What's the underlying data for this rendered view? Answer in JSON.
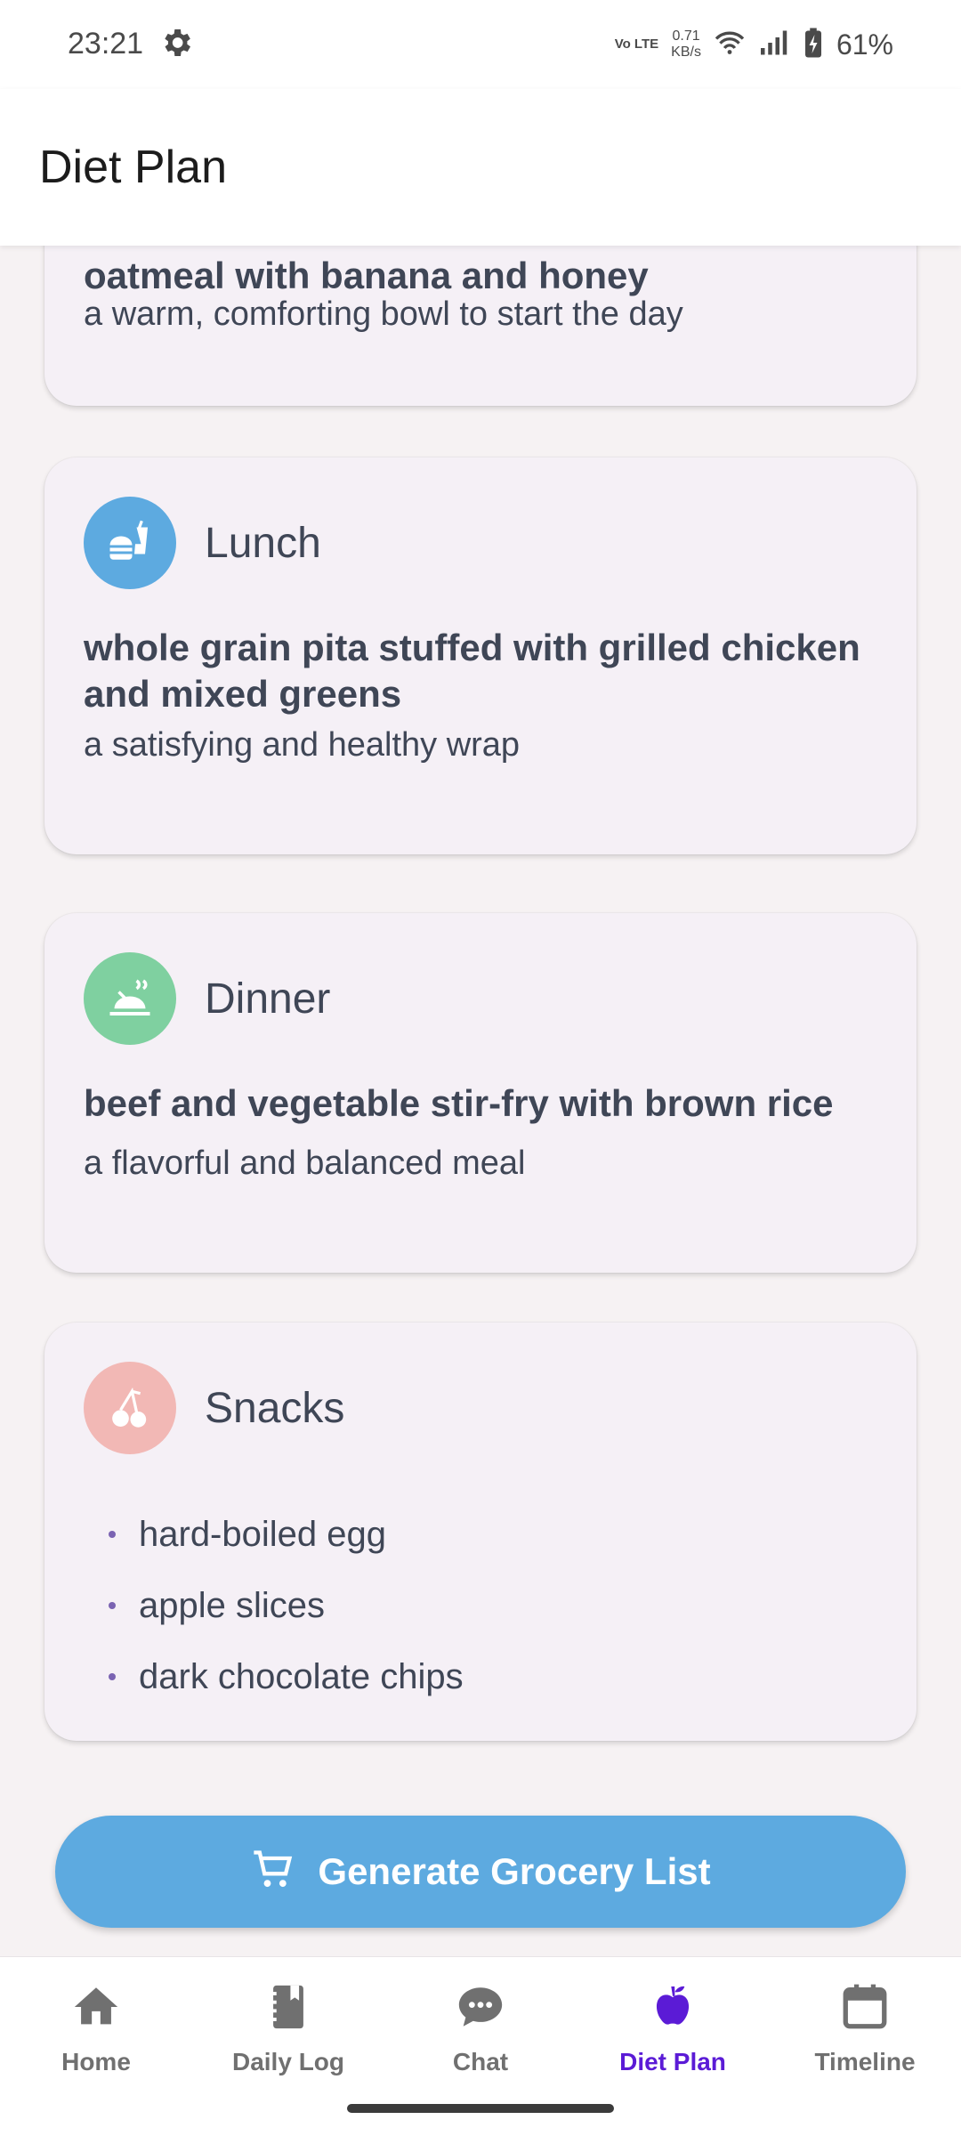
{
  "status_bar": {
    "time": "23:21",
    "network_type": "Vo LTE",
    "speed_value": "0.71",
    "speed_unit": "KB/s",
    "battery": "61%"
  },
  "app_bar": {
    "title": "Diet Plan"
  },
  "meals": {
    "breakfast": {
      "dish": "oatmeal with banana and honey",
      "description": "a warm, comforting bowl to start the day"
    },
    "lunch": {
      "title": "Lunch",
      "icon": "fastfood-icon",
      "icon_color": "#5DAAE0",
      "dish": "whole grain pita stuffed with grilled chicken and mixed greens",
      "description": "a satisfying and healthy wrap"
    },
    "dinner": {
      "title": "Dinner",
      "icon": "dinner-dining-icon",
      "icon_color": "#7FD0A0",
      "dish": "beef and vegetable stir-fry with brown rice",
      "description": "a flavorful and balanced meal"
    },
    "snacks": {
      "title": "Snacks",
      "icon": "cherry-icon",
      "icon_color": "#F2B8B5",
      "items": [
        "hard-boiled egg",
        "apple slices",
        "dark chocolate chips"
      ]
    }
  },
  "grocery_button": {
    "label": "Generate Grocery List",
    "icon": "cart-icon"
  },
  "bottom_nav": {
    "items": [
      {
        "label": "Home",
        "icon": "home-icon",
        "active": false
      },
      {
        "label": "Daily Log",
        "icon": "journal-icon",
        "active": false
      },
      {
        "label": "Chat",
        "icon": "chat-icon",
        "active": false
      },
      {
        "label": "Diet Plan",
        "icon": "apple-icon",
        "active": true
      },
      {
        "label": "Timeline",
        "icon": "calendar-icon",
        "active": false
      }
    ],
    "active_color": "#5B1BD6",
    "inactive_color": "#707070"
  }
}
